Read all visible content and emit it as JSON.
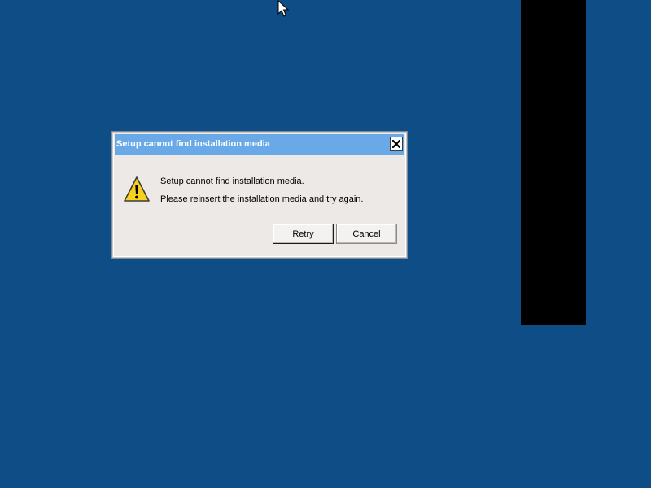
{
  "desktop": {
    "background_color": "#0e4d85"
  },
  "dialog": {
    "title": "Setup cannot find installation media",
    "close_icon": "close-icon",
    "icon": "warning-icon",
    "message_line1": "Setup cannot find installation media.",
    "message_line2": "Please reinsert the installation media and try again.",
    "buttons": {
      "retry": "Retry",
      "cancel": "Cancel"
    },
    "colors": {
      "titlebar": "#69a9e8",
      "body": "#ece9e6"
    }
  },
  "cursor": {
    "icon": "mouse-pointer-icon"
  }
}
